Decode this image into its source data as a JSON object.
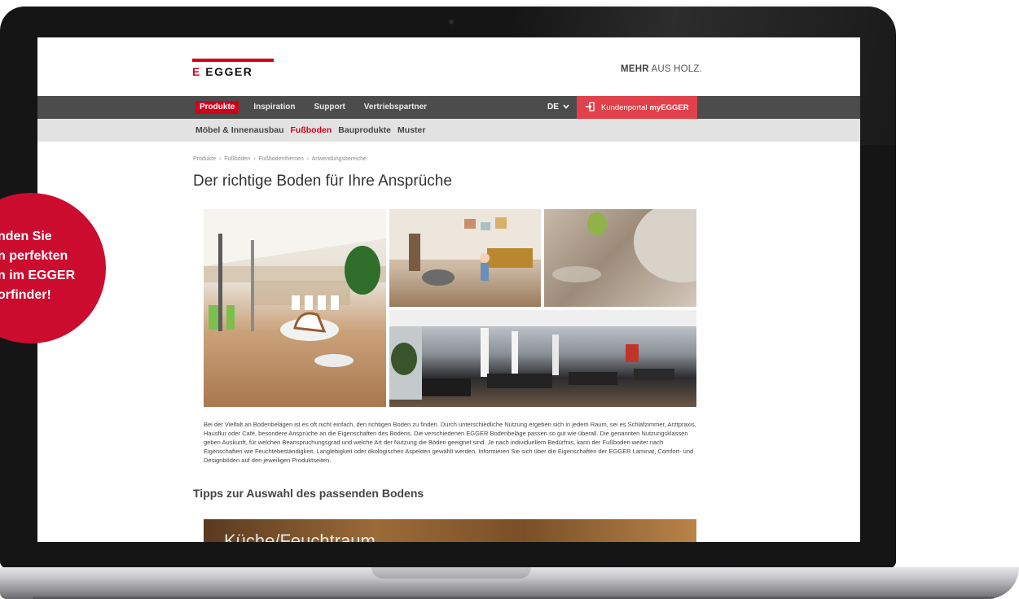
{
  "header": {
    "logo_text": "EGGER",
    "logo_mark": "E",
    "tagline_bold": "MEHR",
    "tagline_rest": "AUS HOLZ."
  },
  "nav": {
    "items": [
      "Produkte",
      "Inspiration",
      "Support",
      "Vertriebspartner"
    ],
    "active_index": 0,
    "language": "DE",
    "portal_label": "Kundenportal",
    "portal_brand": "myEGGER"
  },
  "subnav": {
    "items": [
      "Möbel & Innenausbau",
      "Fußboden",
      "Bauprodukte",
      "Muster"
    ],
    "active_index": 1
  },
  "breadcrumb": [
    "Produkte",
    "Fußboden",
    "Fußbodenthemen",
    "Anwendungsbereiche"
  ],
  "breadcrumb_separator": "›",
  "page_title": "Der richtige Boden für Ihre Ansprüche",
  "body_text": "Bei der Vielfalt an Bodenbelägen ist es oft nicht einfach, den richtigen Boden zu finden. Durch unterschiedliche Nutzung ergeben sich in jedem Raum, sei es Schlafzimmer, Arztpraxis, Hausflur oder Café, besondere Ansprüche an die Eigenschaften des Bodens. Die verschiedenen EGGER Bodenbeläge passen so gut wie überall. Die genannten Nutzungsklassen geben Auskunft, für welchen Beanspruchungsgrad und welche Art der Nutzung die Böden geeignet sind. Je nach individuellem Bedürfnis, kann der Fußboden weiter nach Eigenschaften wie Feuchtebeständigkeit, Langlebigkeit oder ökologischen Aspekten gewählt werden. Informieren Sie sich über die Eigenschaften der EGGER Laminat, Comfort- und Designböden auf den jeweiligen Produktseiten.",
  "section_title": "Tipps zur Auswahl des passenden Bodens",
  "banner_text": "Küche/Feuchtraum",
  "sidebar_icons": [
    "search-icon",
    "phone-icon",
    "star-icon",
    "mail-icon"
  ],
  "badge_text": "nden Sie\nn perfekten\nn im EGGER\norfinder!",
  "colors": {
    "brand_red": "#d0021b",
    "portal_red": "#e0414a",
    "nav_dark": "#4c4c4c",
    "subnav_grey": "#e2e2e2",
    "badge_red": "#cc0c2f"
  }
}
